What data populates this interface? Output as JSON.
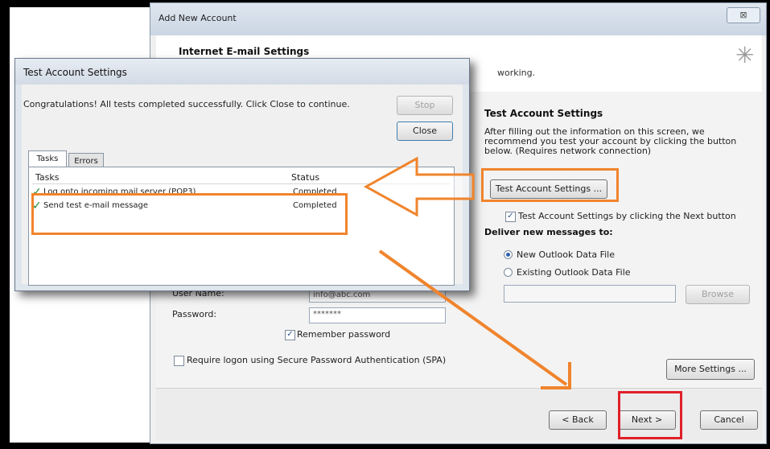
{
  "main_window": {
    "title": "Add New Account",
    "close_glyph": "⊠",
    "header_title": "Internet E-mail Settings",
    "header_subtitle": "working.",
    "header_icon": "cursor-sparkle-icon"
  },
  "right_panel": {
    "section_title": "Test Account Settings",
    "section_desc_1": "After filling out the information on this screen, we",
    "section_desc_2": "recommend you test your account by clicking the button",
    "section_desc_3": "below. (Requires network connection)",
    "test_button": "Test Account Settings ...",
    "test_next_checkbox": "Test Account Settings by clicking the Next button",
    "deliver_title": "Deliver new messages to:",
    "radio_new": "New Outlook Data File",
    "radio_existing": "Existing Outlook Data File",
    "browse_button": "Browse",
    "more_settings_button": "More Settings ..."
  },
  "left_form": {
    "username_label": "User Name:",
    "username_value": "info@abc.com",
    "password_label": "Password:",
    "password_value": "*******",
    "remember_label": "Remember password",
    "spa_label": "Require logon using Secure Password Authentication (SPA)"
  },
  "footer": {
    "back_button": "< Back",
    "next_button": "Next >",
    "cancel_button": "Cancel"
  },
  "test_dialog": {
    "title": "Test Account Settings",
    "message": "Congratulations! All tests completed successfully. Click Close to continue.",
    "stop_button": "Stop",
    "close_button": "Close",
    "tabs": [
      "Tasks",
      "Errors"
    ],
    "columns": [
      "Tasks",
      "Status"
    ],
    "rows": [
      {
        "task": "Log onto incoming mail server (POP3)",
        "status": "Completed"
      },
      {
        "task": "Send test e-mail message",
        "status": "Completed"
      }
    ]
  },
  "colors": {
    "highlight_orange": "#f0842c",
    "highlight_red": "#e0202a",
    "check_green": "#1f8a2e"
  }
}
